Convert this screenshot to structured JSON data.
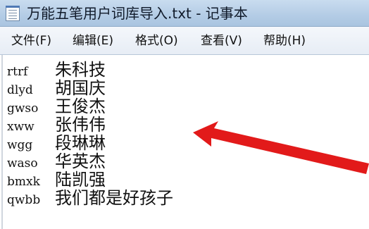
{
  "window": {
    "title": "万能五笔用户词库导入.txt - 记事本"
  },
  "menubar": {
    "items": [
      {
        "id": "file",
        "label": "文件(F)"
      },
      {
        "id": "edit",
        "label": "编辑(E)"
      },
      {
        "id": "format",
        "label": "格式(O)"
      },
      {
        "id": "view",
        "label": "查看(V)"
      },
      {
        "id": "help",
        "label": "帮助(H)"
      }
    ]
  },
  "document": {
    "lines": [
      {
        "code": "rtrf",
        "word": "朱科技"
      },
      {
        "code": "dlyd",
        "word": "胡国庆"
      },
      {
        "code": "gwso",
        "word": "王俊杰"
      },
      {
        "code": "xww",
        "word": "张伟伟"
      },
      {
        "code": "wgg",
        "word": "段琳琳"
      },
      {
        "code": "waso",
        "word": "华英杰"
      },
      {
        "code": "bmxk",
        "word": "陆凯强"
      },
      {
        "code": "qwbb",
        "word": "我们都是好孩子"
      }
    ]
  },
  "annotation": {
    "arrow_color": "#e21a1a"
  },
  "icons": {
    "app": "notepad-icon"
  }
}
